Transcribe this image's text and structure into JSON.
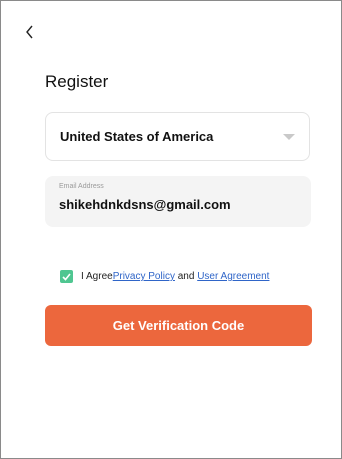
{
  "header": {
    "back_icon": "chevron-left-icon"
  },
  "title": "Register",
  "country": {
    "value": "United States of America",
    "caret_icon": "caret-down-icon"
  },
  "email": {
    "label": "Email Address",
    "value": "shikehdnkdsns@gmail.com"
  },
  "agreement": {
    "checked": true,
    "check_icon": "checkmark-icon",
    "check_color": "#4fc691",
    "prefix": "I Agree",
    "privacy_link": "Privacy Policy",
    "connector": " and ",
    "user_agreement_link": "User Agreement",
    "link_color": "#2f65c8"
  },
  "cta": {
    "label": "Get Verification Code",
    "color": "#ec673d"
  }
}
